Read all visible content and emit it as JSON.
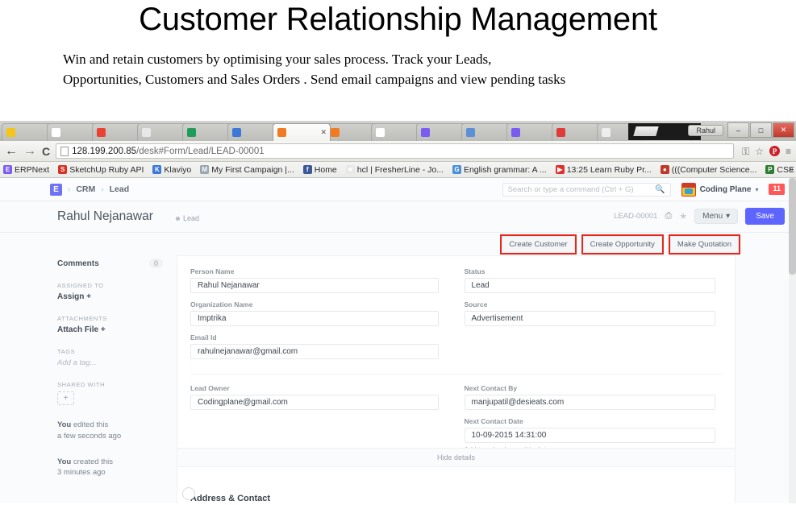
{
  "slide": {
    "title": "Customer Relationship Management",
    "line1": "Win  and  retain     customers  by  optimising  your  sales  process.   Track   your   Leads,",
    "line2": "Opportunities,  Customers and Sales Orders . Send email campaigns and view pending tasks"
  },
  "browser": {
    "window_user": "Rahul",
    "minimize": "–",
    "maximize": "□",
    "close": "✕",
    "back_arrow": "←",
    "forward_arrow": "→",
    "reload": "C",
    "url_host": "128.199.200.85",
    "url_path": "/desk#Form/Lead/LEAD-00001",
    "toolbar_icons": [
      "key-icon",
      "bookmark-star-icon",
      "pinterest-icon",
      "chrome-menu-icon"
    ],
    "pinterest_glyph": "P",
    "menu_glyph": "≡",
    "bookmarks_overflow": "»",
    "tabs": [
      {
        "favicon_color": "#f5c518",
        "active": false
      },
      {
        "favicon_color": "#ffffff",
        "active": false
      },
      {
        "favicon_color": "#ea4335",
        "active": false
      },
      {
        "favicon_color": "#e8e8e8",
        "active": false
      },
      {
        "favicon_color": "#1d9d58",
        "active": false
      },
      {
        "favicon_color": "#3c78d8",
        "active": false
      },
      {
        "favicon_color": "#f07b22",
        "active": true
      },
      {
        "favicon_color": "#f07b22",
        "active": false
      },
      {
        "favicon_color": "#ffffff",
        "active": false
      },
      {
        "favicon_color": "#7b5cf0",
        "active": false
      },
      {
        "favicon_color": "#5b8fd6",
        "active": false
      },
      {
        "favicon_color": "#7b5cf0",
        "active": false
      },
      {
        "favicon_color": "#e03b3b",
        "active": false
      },
      {
        "favicon_color": "#eeeeee",
        "active": false
      },
      {
        "favicon_color": "#4285f4",
        "active": false
      }
    ],
    "bookmarks": [
      {
        "label": "ERPNext",
        "color": "#7b5cf0",
        "glyph": "E"
      },
      {
        "label": "SketchUp Ruby API",
        "color": "#d93025",
        "glyph": "S"
      },
      {
        "label": "Klaviyo",
        "color": "#3c78d8",
        "glyph": "K"
      },
      {
        "label": "My First Campaign |...",
        "color": "#9aa6b2",
        "glyph": "M"
      },
      {
        "label": "Home",
        "color": "#3b5998",
        "glyph": "f"
      },
      {
        "label": "hcl | FresherLine - Jo...",
        "color": "#e8e8e8",
        "glyph": "★"
      },
      {
        "label": "English grammar: A ...",
        "color": "#4a90d9",
        "glyph": "G"
      },
      {
        "label": "13:25 Learn Ruby Pr...",
        "color": "#e02f2f",
        "glyph": "▶"
      },
      {
        "label": "(((Computer Science...",
        "color": "#c0392b",
        "glyph": "●"
      },
      {
        "label": "CSE Seminar Topic | ...",
        "color": "#2e7d32",
        "glyph": "P"
      }
    ]
  },
  "app": {
    "logo_glyph": "E",
    "breadcrumb": [
      "CRM",
      "Lead"
    ],
    "breadcrumb_separator": "›",
    "search": {
      "placeholder": "Search or type a command (Ctrl + G)",
      "icon": "🔍"
    },
    "user": {
      "name": "Coding Plane",
      "caret": "▾"
    },
    "notification_badge": "11",
    "title": {
      "doc_name": "Rahul Nejanawar",
      "status": "Lead",
      "doc_id": "LEAD-00001",
      "print_icon": "⎙",
      "star_icon": "★",
      "menu_label": "Menu",
      "menu_caret": "▾",
      "save_label": "Save"
    },
    "actions": [
      {
        "label": "Create Customer",
        "highlighted": true
      },
      {
        "label": "Create Opportunity",
        "highlighted": true
      },
      {
        "label": "Make Quotation",
        "highlighted": true
      }
    ],
    "sidebar": {
      "comments_label": "Comments",
      "comments_count": "0",
      "assigned_to_label": "ASSIGNED TO",
      "assign_action": "Assign +",
      "attachments_label": "ATTACHMENTS",
      "attach_action": "Attach File +",
      "tags_label": "TAGS",
      "tags_placeholder": "Add a tag...",
      "shared_with_label": "SHARED WITH",
      "shared_add": "+",
      "edited_who": "You",
      "edited_what": " edited this",
      "edited_when": "a few seconds ago",
      "created_who": "You",
      "created_what": " created this",
      "created_when": "3 minutes ago"
    },
    "form": {
      "fields_left": [
        {
          "label": "Person Name",
          "value": "Rahul Nejanawar"
        },
        {
          "label": "Organization Name",
          "value": "Imptrika"
        },
        {
          "label": "Email Id",
          "value": "rahulnejanawar@gmail.com"
        }
      ],
      "fields_right": [
        {
          "label": "Status",
          "value": "Lead"
        },
        {
          "label": "Source",
          "value": "Advertisement"
        }
      ],
      "fields_left_2": [
        {
          "label": "Lead Owner",
          "value": "Codingplane@gmail.com"
        }
      ],
      "fields_right_2": [
        {
          "label": "Next Contact By",
          "value": "manjupatil@desieats.com"
        },
        {
          "label": "Next Contact Date",
          "value": "10-09-2015 14:31:00",
          "hint": "Add to calendar on this date"
        }
      ],
      "hide_details": "Hide details",
      "next_section": "Address & Contact"
    }
  },
  "colors": {
    "accent": "#5e64ff",
    "highlight": "#e8271c",
    "badge": "#ff5858"
  }
}
